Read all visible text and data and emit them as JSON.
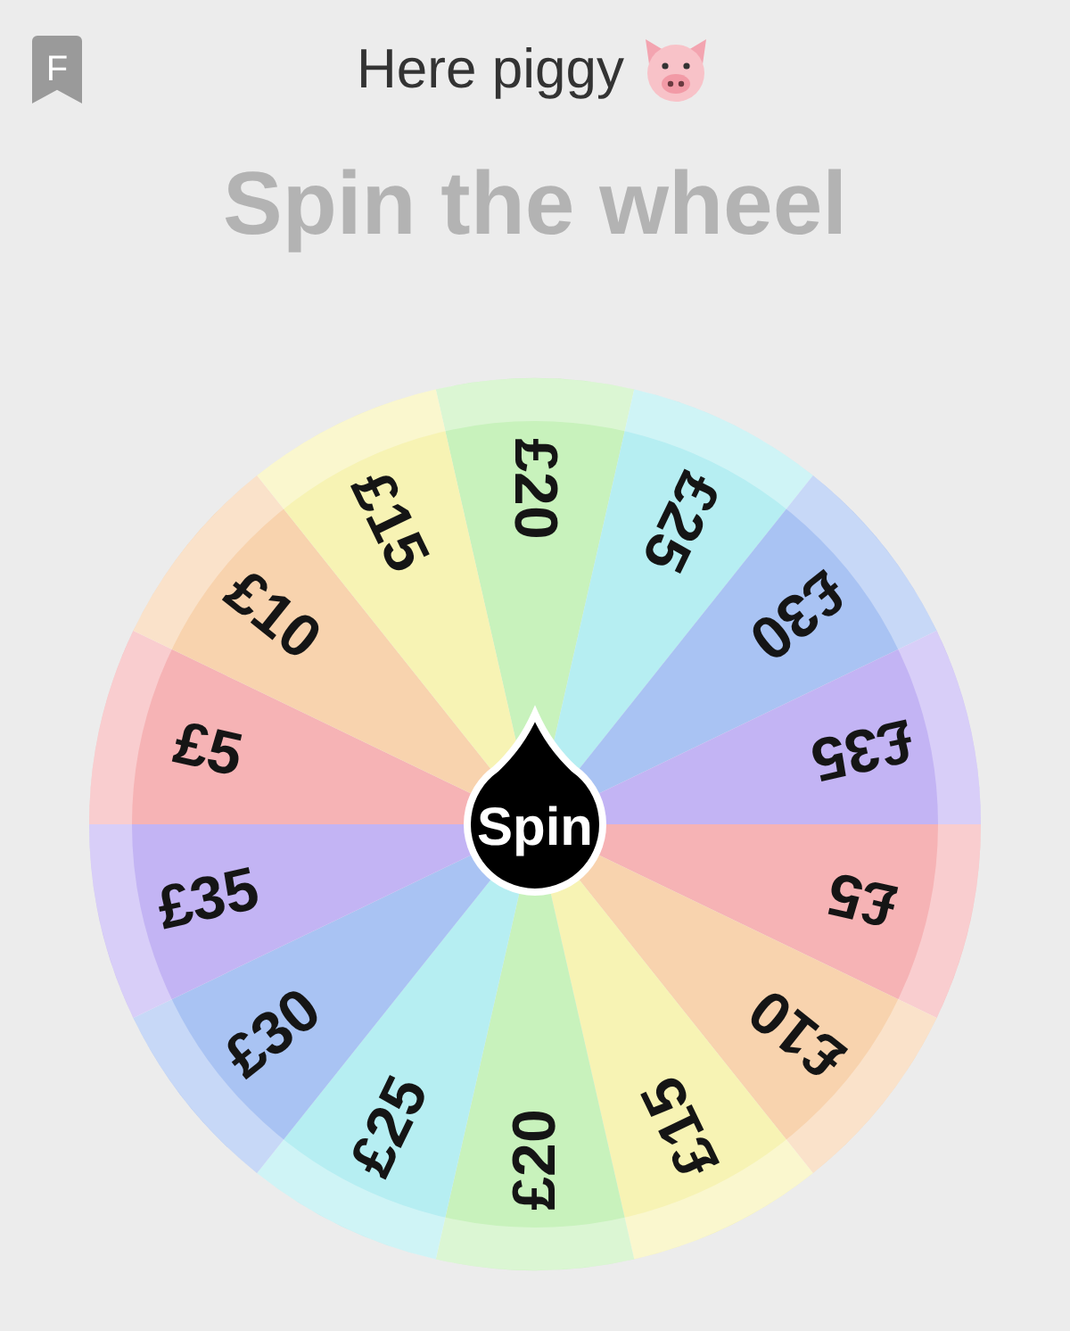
{
  "bookmark": {
    "label": "F"
  },
  "header": {
    "title": "Here piggy"
  },
  "heading": "Spin the wheel",
  "wheel": {
    "button": "Spin",
    "segments": [
      {
        "label": "£20",
        "color": "#c8f2bc"
      },
      {
        "label": "£25",
        "color": "#b6eef2"
      },
      {
        "label": "£30",
        "color": "#a9c3f3"
      },
      {
        "label": "£35",
        "color": "#c3b4f4"
      },
      {
        "label": "£5",
        "color": "#f6b3b5"
      },
      {
        "label": "£10",
        "color": "#f8d3ae"
      },
      {
        "label": "£15",
        "color": "#f7f3b4"
      },
      {
        "label": "£20",
        "color": "#c8f2bc"
      },
      {
        "label": "£25",
        "color": "#b6eef2"
      },
      {
        "label": "£30",
        "color": "#a9c3f3"
      },
      {
        "label": "£35",
        "color": "#c3b4f4"
      },
      {
        "label": "£5",
        "color": "#f6b3b5"
      },
      {
        "label": "£10",
        "color": "#f8d3ae"
      },
      {
        "label": "£15",
        "color": "#f7f3b4"
      }
    ]
  }
}
